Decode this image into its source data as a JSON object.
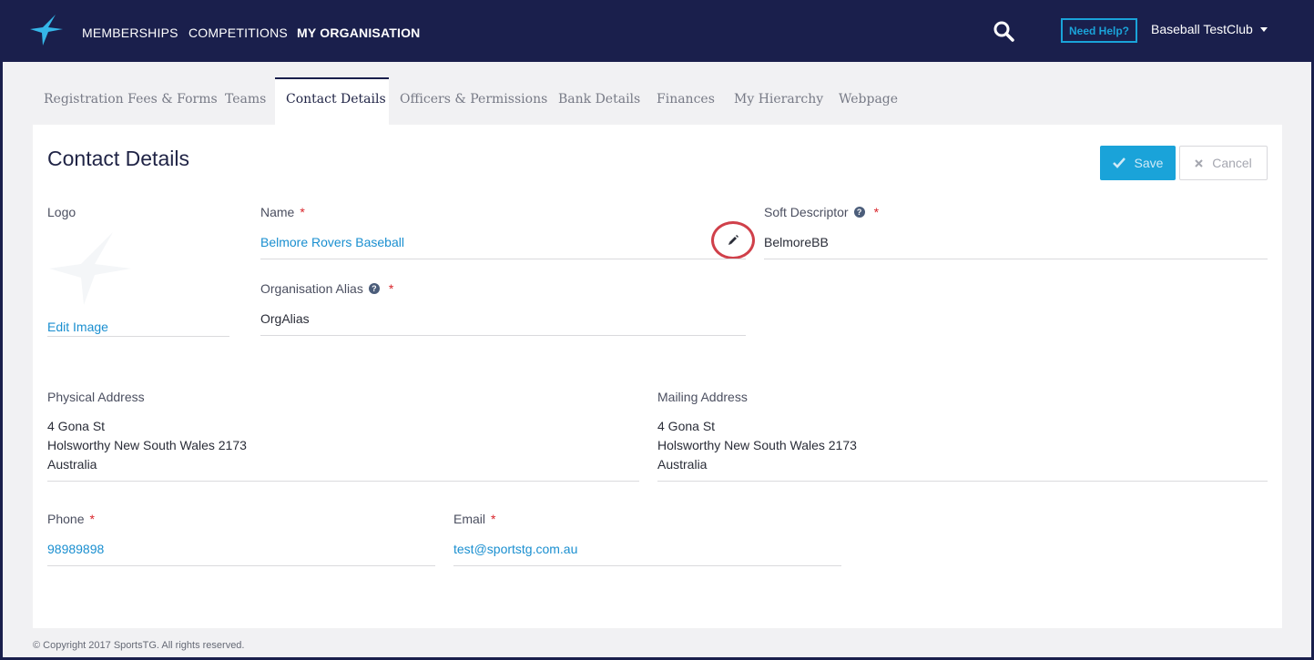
{
  "nav": {
    "items": [
      {
        "label": "MEMBERSHIPS"
      },
      {
        "label": "COMPETITIONS"
      },
      {
        "label": "MY ORGANISATION"
      }
    ],
    "help_label": "Need Help?",
    "user_label": "Baseball TestClub"
  },
  "tabs": [
    {
      "label": "Registration Fees & Forms"
    },
    {
      "label": "Teams"
    },
    {
      "label": "Contact Details"
    },
    {
      "label": "Officers & Permissions"
    },
    {
      "label": "Bank Details"
    },
    {
      "label": "Finances"
    },
    {
      "label": "My Hierarchy"
    },
    {
      "label": "Webpage"
    }
  ],
  "active_tab": "Contact Details",
  "page": {
    "title": "Contact Details",
    "save_label": "Save",
    "cancel_label": "Cancel"
  },
  "form": {
    "logo_label": "Logo",
    "edit_image_label": "Edit Image",
    "name_label": "Name",
    "name_value": "Belmore Rovers Baseball",
    "soft_descriptor_label": "Soft Descriptor",
    "soft_descriptor_value": "BelmoreBB",
    "alias_label": "Organisation Alias",
    "alias_value": "OrgAlias",
    "physical_label": "Physical Address",
    "physical_lines": [
      "4 Gona St",
      "Holsworthy New South Wales 2173",
      "Australia"
    ],
    "mailing_label": "Mailing Address",
    "mailing_lines": [
      "4 Gona St",
      "Holsworthy New South Wales 2173",
      "Australia"
    ],
    "phone_label": "Phone",
    "phone_value": "98989898",
    "email_label": "Email",
    "email_value": "test@sportstg.com.au",
    "required_mark": "*",
    "help_mark": "?"
  },
  "footer": "© Copyright 2017 SportsTG. All rights reserved.",
  "colors": {
    "header_bg": "#1a1f4c",
    "accent": "#1aa3d9",
    "link": "#1a8fd0",
    "required": "#d9242a",
    "highlight_circle": "#d0404a"
  }
}
